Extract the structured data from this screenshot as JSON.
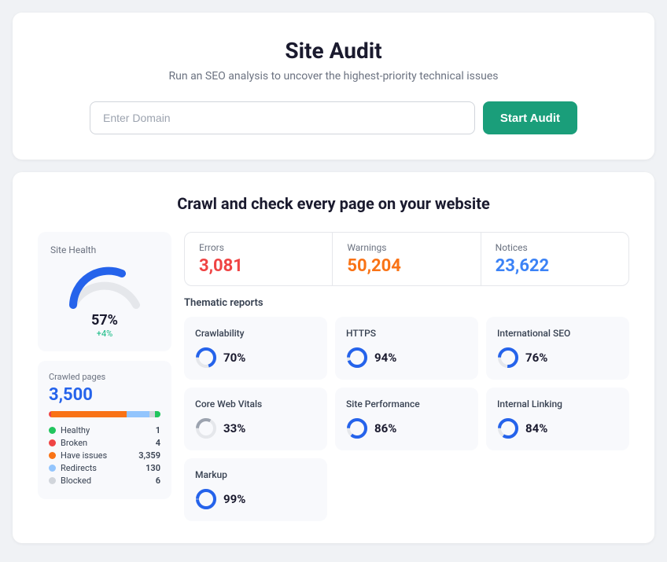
{
  "header": {
    "title": "Site Audit",
    "subtitle": "Run an SEO analysis to uncover the highest-priority technical issues",
    "input_placeholder": "Enter Domain",
    "btn_label": "Start Audit"
  },
  "section": {
    "title": "Crawl and check every page on your website"
  },
  "site_health": {
    "label": "Site Health",
    "percent": "57%",
    "delta": "+4%"
  },
  "crawled": {
    "label": "Crawled pages",
    "count": "3,500",
    "legend": [
      {
        "name": "Healthy",
        "count": "1",
        "color": "#22c55e"
      },
      {
        "name": "Broken",
        "count": "4",
        "color": "#ef4444"
      },
      {
        "name": "Have issues",
        "count": "3,359",
        "color": "#f97316"
      },
      {
        "name": "Redirects",
        "count": "130",
        "color": "#93c5fd"
      },
      {
        "name": "Blocked",
        "count": "6",
        "color": "#d1d5db"
      }
    ],
    "bar": [
      {
        "color": "#ef4444",
        "pct": 2
      },
      {
        "color": "#f97316",
        "pct": 68
      },
      {
        "color": "#93c5fd",
        "pct": 20
      },
      {
        "color": "#d1d5db",
        "pct": 5
      },
      {
        "color": "#22c55e",
        "pct": 5
      }
    ]
  },
  "metrics": [
    {
      "label": "Errors",
      "value": "3,081",
      "cls": "errors"
    },
    {
      "label": "Warnings",
      "value": "50,204",
      "cls": "warnings"
    },
    {
      "label": "Notices",
      "value": "23,622",
      "cls": "notices"
    }
  ],
  "thematic": {
    "label": "Thematic reports",
    "reports": [
      {
        "title": "Crawlability",
        "pct": 70,
        "color": "#2563eb"
      },
      {
        "title": "HTTPS",
        "pct": 94,
        "color": "#2563eb"
      },
      {
        "title": "International SEO",
        "pct": 76,
        "color": "#2563eb"
      },
      {
        "title": "Core Web Vitals",
        "pct": 33,
        "color": "#9ca3af"
      },
      {
        "title": "Site Performance",
        "pct": 86,
        "color": "#2563eb"
      },
      {
        "title": "Internal Linking",
        "pct": 84,
        "color": "#2563eb"
      },
      {
        "title": "Markup",
        "pct": 99,
        "color": "#2563eb"
      }
    ]
  }
}
